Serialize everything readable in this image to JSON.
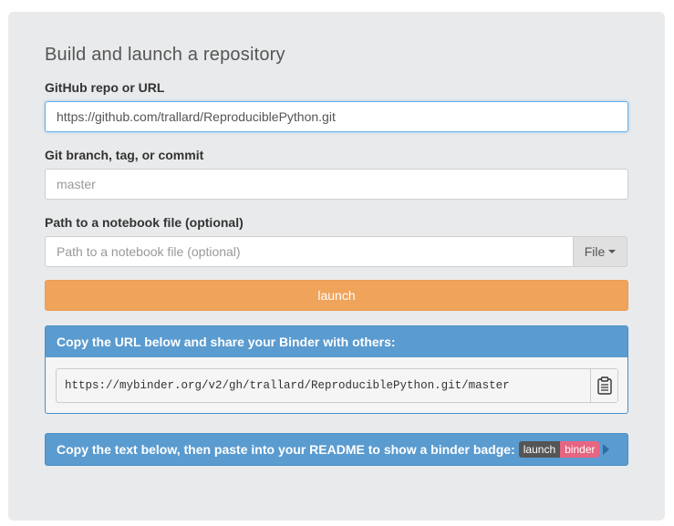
{
  "form": {
    "title": "Build and launch a repository",
    "repo": {
      "label": "GitHub repo or URL",
      "value": "https://github.com/trallard/ReproduciblePython.git",
      "placeholder": ""
    },
    "ref": {
      "label": "Git branch, tag, or commit",
      "value": "",
      "placeholder": "master"
    },
    "filepath": {
      "label": "Path to a notebook file (optional)",
      "value": "",
      "placeholder": "Path to a notebook file (optional)",
      "type_button": "File"
    },
    "launch_label": "launch"
  },
  "share": {
    "header": "Copy the URL below and share your Binder with others:",
    "url": "https://mybinder.org/v2/gh/trallard/ReproduciblePython.git/master"
  },
  "badge": {
    "text": "Copy the text below, then paste into your README to show a binder badge:",
    "left": "launch",
    "right": "binder"
  },
  "colors": {
    "panel_bg": "#e9eaeb",
    "launch_orange": "#f0a35b",
    "header_blue": "#5a9bd0",
    "badge_pink": "#e66581"
  }
}
